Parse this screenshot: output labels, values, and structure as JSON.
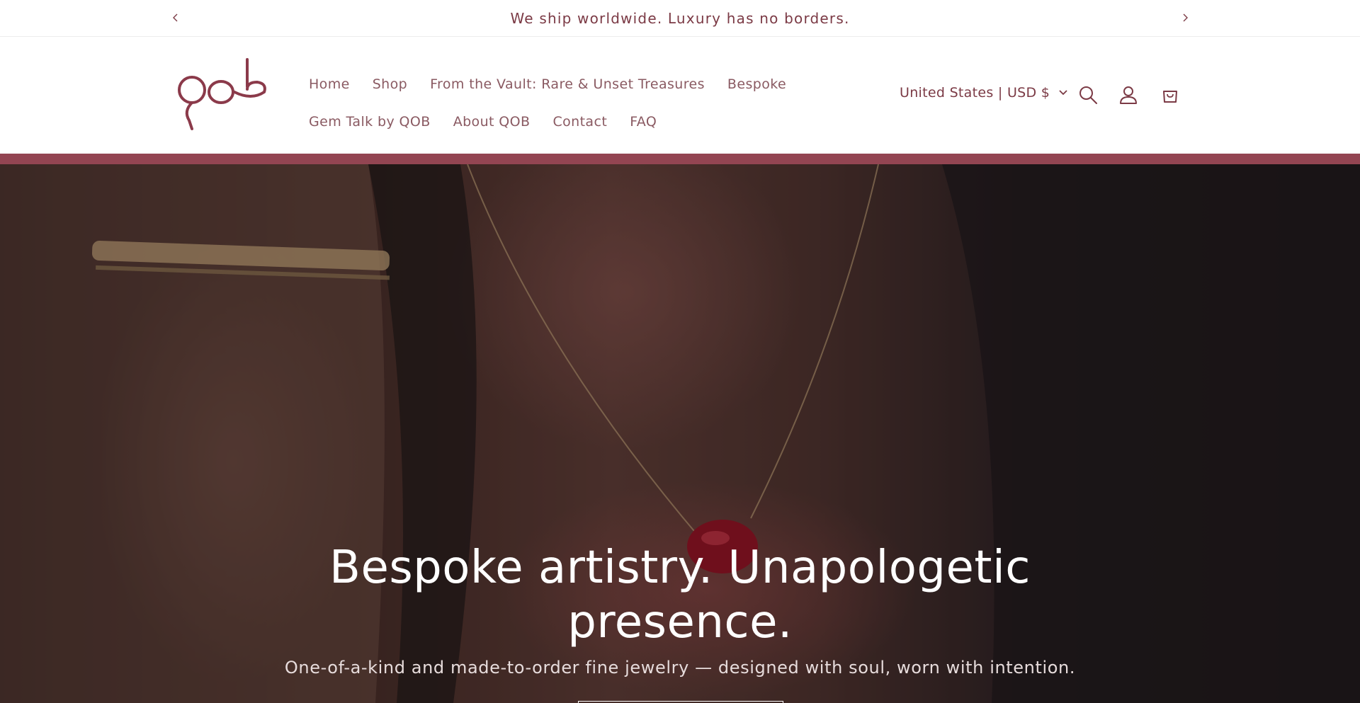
{
  "announcement": {
    "text": "We ship worldwide. Luxury has no borders."
  },
  "header": {
    "logo_text": "qob",
    "nav": {
      "row1": [
        "Home",
        "Shop",
        "From the Vault: Rare & Unset Treasures",
        "Bespoke"
      ],
      "row2": [
        "Gem Talk by QOB",
        "About QOB",
        "Contact",
        "FAQ"
      ]
    },
    "currency_label": "United States | USD $",
    "icons": [
      "search-icon",
      "account-icon",
      "cart-icon"
    ]
  },
  "hero": {
    "title": "Bespoke artistry. Unapologetic presence.",
    "subtitle": "One-of-a-kind and made-to-order fine jewelry — designed with soul, worn with intention."
  },
  "colors": {
    "brand": "#7b3a45",
    "nav_text": "#8a5a62",
    "stripe": "#934552"
  }
}
